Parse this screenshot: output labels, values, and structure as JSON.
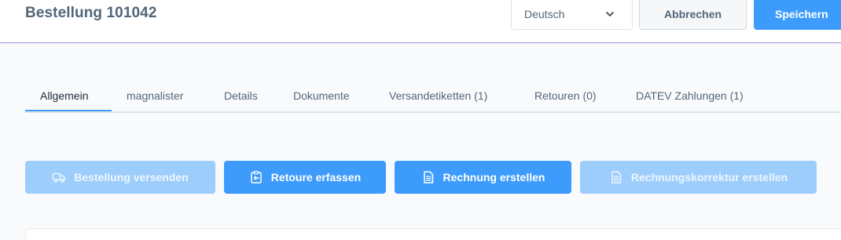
{
  "header": {
    "title": "Bestellung 101042",
    "language": "Deutsch",
    "cancel_label": "Abbrechen",
    "save_label": "Speichern"
  },
  "tabs": [
    {
      "label": "Allgemein",
      "active": true
    },
    {
      "label": "magnalister"
    },
    {
      "label": "Details"
    },
    {
      "label": "Dokumente"
    },
    {
      "label": "Versandetiketten (1)"
    },
    {
      "label": "Retouren (0)"
    },
    {
      "label": "DATEV Zahlungen (1)"
    }
  ],
  "actions": [
    {
      "label": "Bestellung versenden",
      "icon": "truck-icon",
      "disabled": true
    },
    {
      "label": "Retoure erfassen",
      "icon": "return-icon",
      "disabled": false
    },
    {
      "label": "Rechnung erstellen",
      "icon": "document-icon",
      "disabled": false
    },
    {
      "label": "Rechnungskorrektur erstellen",
      "icon": "document-icon",
      "disabled": true
    }
  ],
  "colors": {
    "accent": "#3d9bfb",
    "accent_disabled": "#9ccdfb",
    "text": "#52667a"
  }
}
